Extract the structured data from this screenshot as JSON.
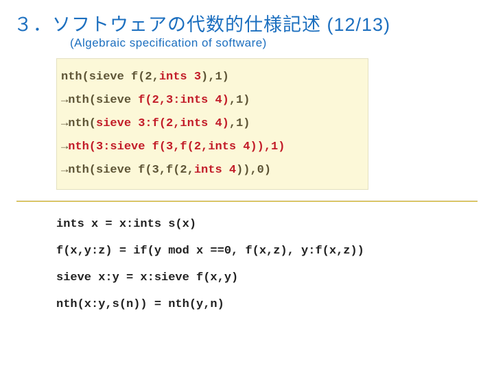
{
  "title": {
    "heading": "３．ソフトウェアの代数的仕様記述",
    "count": "(12/13)",
    "subtitle": "(Algebraic specification of software)"
  },
  "derivation": {
    "lines": [
      {
        "prefix": "nth",
        "paren": "(sieve f(2,",
        "hi": "ints 3",
        "rest": "),1)"
      },
      {
        "arrow": "→",
        "prefix": "nth",
        "paren": "(sieve ",
        "hi": "f(2,3:ints 4)",
        "rest": ",1)"
      },
      {
        "arrow": "→",
        "prefix": "nth(",
        "hi": "sieve 3:f(2,ints 4)",
        "rest": ",1)"
      },
      {
        "arrow": "→",
        "hi": "nth(3:sieve f(3,f(2,ints 4)),1)",
        "rest": ""
      },
      {
        "arrow": "→",
        "prefix": "nth(sieve f(3,f(2,",
        "hi": "ints 4",
        "rest": ")),0)"
      }
    ]
  },
  "definitions": [
    "ints x = x:ints s(x)",
    "f(x,y:z) = if(y mod x ==0, f(x,z), y:f(x,z))",
    "sieve x:y = x:sieve f(x,y)",
    "nth(x:y,s(n)) = nth(y,n)"
  ]
}
